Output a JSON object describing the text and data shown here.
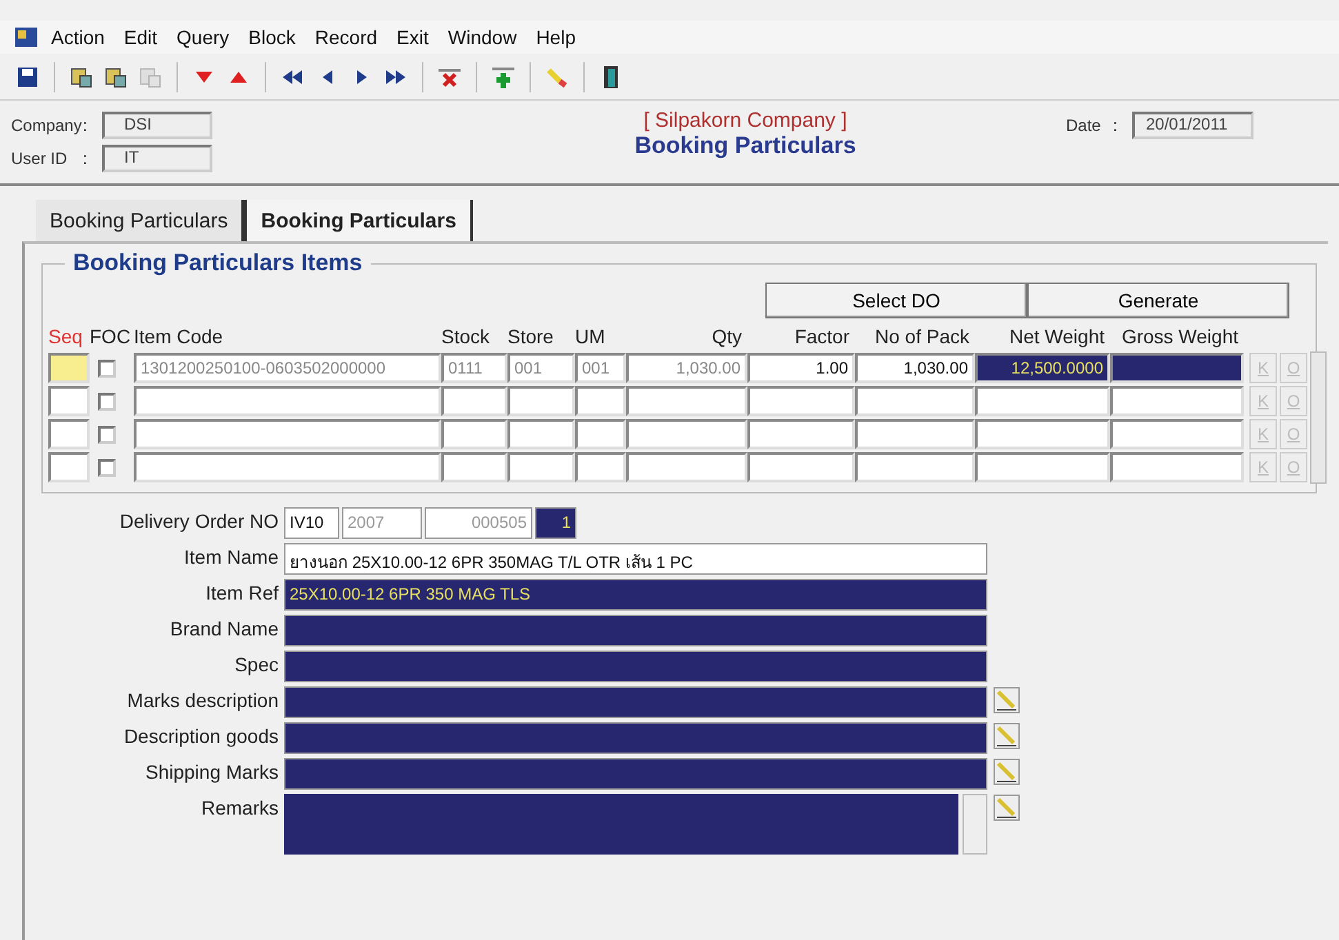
{
  "menu": [
    "Action",
    "Edit",
    "Query",
    "Block",
    "Record",
    "Exit",
    "Window",
    "Help"
  ],
  "toolbar": [
    {
      "kind": "save",
      "disabled": false
    },
    {
      "kind": "sep"
    },
    {
      "kind": "query",
      "disabled": false
    },
    {
      "kind": "query-run",
      "disabled": false
    },
    {
      "kind": "query-cancel",
      "disabled": true
    },
    {
      "kind": "sep"
    },
    {
      "kind": "down",
      "disabled": false
    },
    {
      "kind": "up",
      "disabled": false
    },
    {
      "kind": "sep"
    },
    {
      "kind": "first",
      "disabled": false
    },
    {
      "kind": "prev",
      "disabled": false
    },
    {
      "kind": "next",
      "disabled": false
    },
    {
      "kind": "last",
      "disabled": false
    },
    {
      "kind": "sep"
    },
    {
      "kind": "delete",
      "disabled": false
    },
    {
      "kind": "sep"
    },
    {
      "kind": "insert",
      "disabled": false
    },
    {
      "kind": "sep"
    },
    {
      "kind": "clear",
      "disabled": false
    },
    {
      "kind": "sep"
    },
    {
      "kind": "exit",
      "disabled": false
    }
  ],
  "header": {
    "company_label": "Company",
    "company_sep": ":",
    "company": "DSI",
    "user_label": "User ID",
    "user_sep": ":",
    "user": "IT",
    "company_name": "[ Silpakorn Company ]",
    "form_title": "Booking Particulars",
    "date_label": "Date",
    "date_sep": ":",
    "date": "20/01/2011"
  },
  "tabs": [
    {
      "label": "Booking Particulars",
      "selected": false
    },
    {
      "label": "Booking Particulars",
      "selected": true
    }
  ],
  "section_title": "Booking Particulars Items",
  "action_buttons": [
    "Select DO",
    "Generate"
  ],
  "columns": [
    "Seq",
    "FOC",
    "Item Code",
    "Stock",
    "Store",
    "UM",
    "Qty",
    "Factor",
    "No of Pack",
    "Net Weight",
    "Gross Weight"
  ],
  "rows": [
    {
      "selected": true,
      "foc": false,
      "item_code": "1301200250100-0603502000000",
      "stock": "0111",
      "store": "001",
      "um": "001",
      "qty": "1,030.00",
      "factor": "1.00",
      "no_of_pack": "1,030.00",
      "net_weight": "12,500.0000",
      "buttons": [
        "K",
        "O"
      ]
    },
    {
      "selected": false,
      "foc": false,
      "buttons": [
        "K",
        "O"
      ]
    },
    {
      "selected": false,
      "foc": false,
      "buttons": [
        "K",
        "O"
      ]
    },
    {
      "selected": false,
      "foc": false,
      "buttons": [
        "K",
        "O"
      ]
    }
  ],
  "delivery_order": {
    "label": "Delivery Order NO",
    "parts": [
      {
        "value": "IV10",
        "kind": "plain"
      },
      {
        "value": "2007",
        "kind": "grey"
      },
      {
        "value": "000505",
        "kind": "grey-right"
      },
      {
        "value": "1",
        "kind": "dark"
      }
    ]
  },
  "details": [
    {
      "label": "Item Name",
      "value": "ยางนอก 25X10.00-12 6PR 350MAG T/L OTR เส้น 1 PC",
      "kind": "plain",
      "editor": false
    },
    {
      "label": "Item Ref",
      "value": "25X10.00-12 6PR 350 MAG TLS",
      "kind": "dark",
      "editor": false
    },
    {
      "label": "Brand Name",
      "kind": "dark",
      "editor": false
    },
    {
      "label": "Spec",
      "kind": "dark",
      "editor": false
    },
    {
      "label": "Marks description",
      "kind": "dark",
      "editor": true
    },
    {
      "label": "Description goods",
      "kind": "dark",
      "editor": true
    },
    {
      "label": "Shipping Marks",
      "kind": "dark",
      "editor": true
    },
    {
      "label": "Remarks",
      "kind": "memo",
      "editor": true
    }
  ]
}
